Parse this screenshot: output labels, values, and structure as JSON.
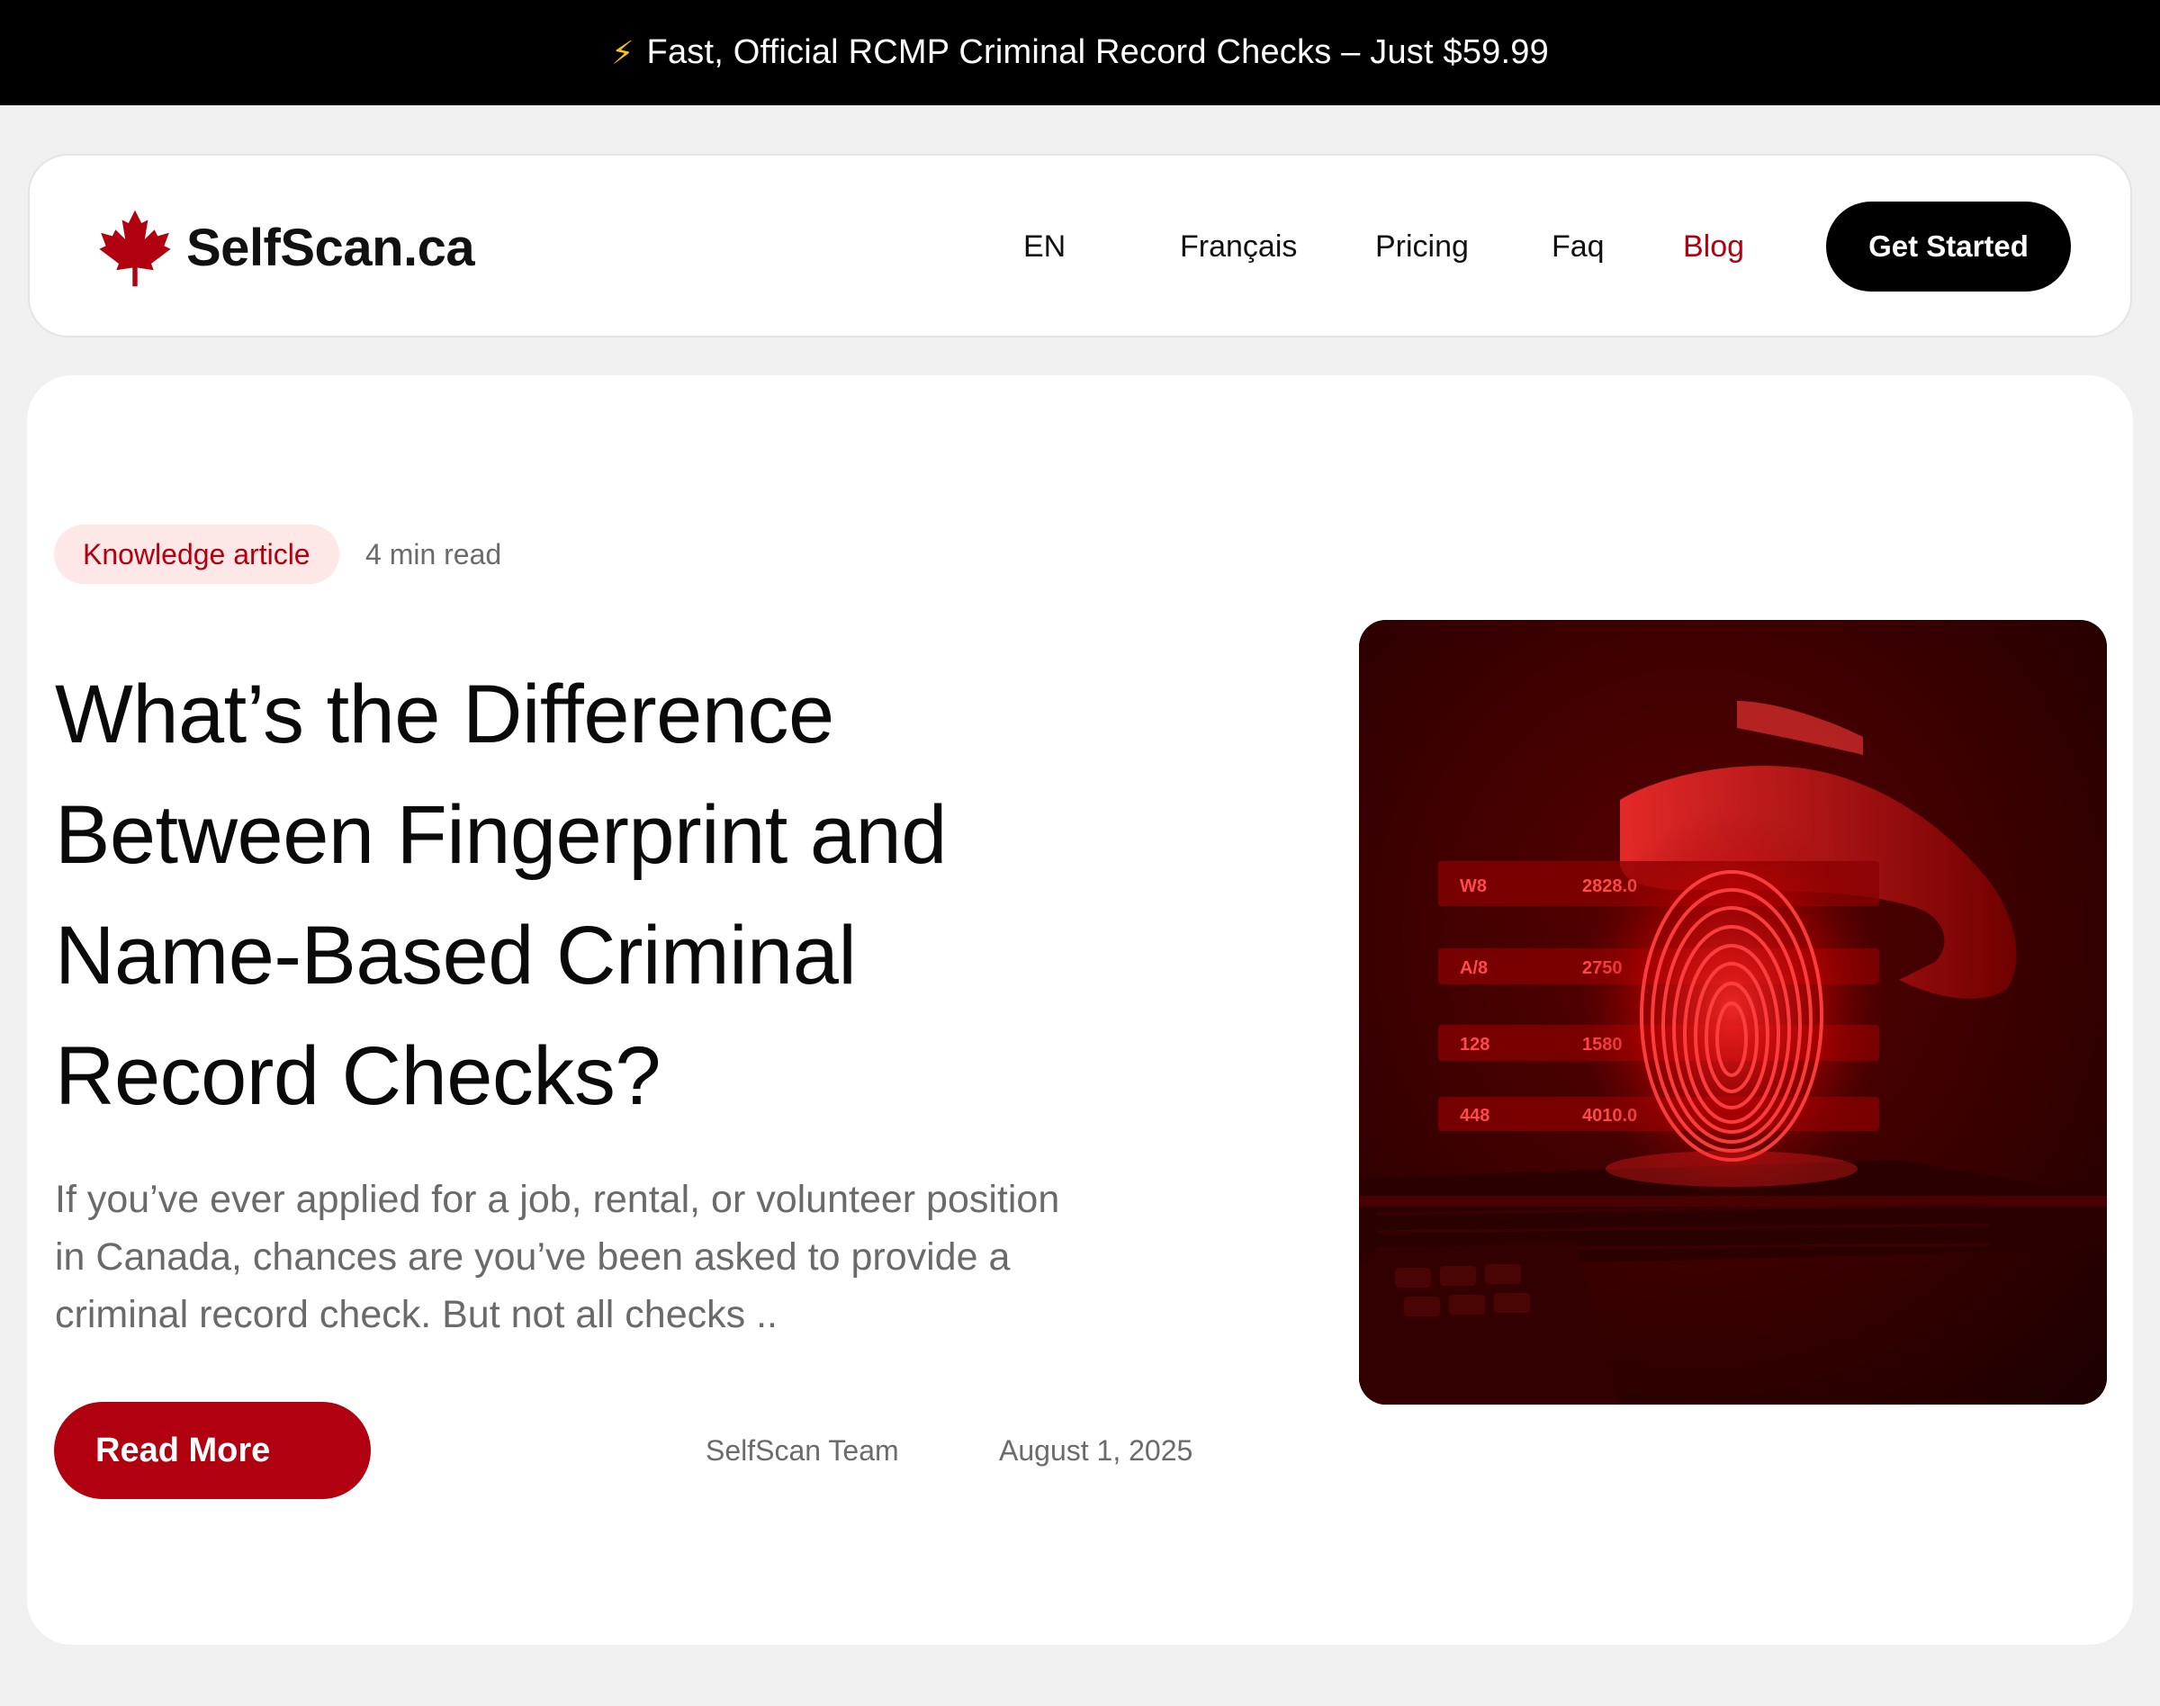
{
  "announcement": {
    "icon": "lightning-bolt-icon",
    "text": "Fast, Official RCMP Criminal Record Checks – Just $59.99"
  },
  "nav": {
    "brand": "SelfScan.ca",
    "logo_icon": "maple-leaf-icon",
    "links": {
      "en": "EN",
      "francais": "Français",
      "pricing": "Pricing",
      "faq": "Faq",
      "blog": "Blog"
    },
    "active_link": "Blog",
    "cta": "Get Started"
  },
  "article": {
    "category": "Knowledge article",
    "read_time": "4 min read",
    "title_lines": [
      "What’s the Difference",
      "Between Fingerprint and",
      "Name-Based Criminal",
      "Record Checks?"
    ],
    "excerpt_lines": [
      "If you’ve ever applied for a job, rental, or volunteer position",
      "in Canada, chances are you’ve been asked to provide a",
      "criminal record check. But not all checks .."
    ],
    "read_more": "Read More",
    "author": "SelfScan Team",
    "date": "August 1, 2025",
    "image_icon": "fingerprint-scan-image",
    "image_readouts": [
      {
        "label": "W8",
        "value": "2828.0"
      },
      {
        "label": "A/8",
        "value": "2750"
      },
      {
        "label": "128",
        "value": "1580"
      },
      {
        "label": "448",
        "value": "4010.0"
      }
    ]
  },
  "colors": {
    "accent": "#b1000f",
    "badge_bg": "#fde7e7",
    "topbar_bg": "#000000",
    "page_bg": "#f0f0f0"
  }
}
